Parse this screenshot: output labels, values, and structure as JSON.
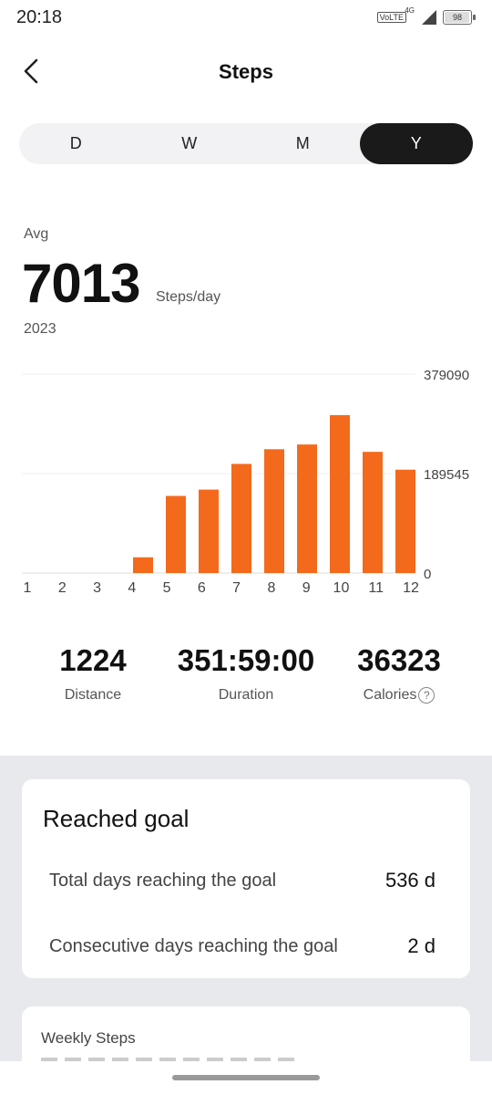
{
  "status_bar": {
    "time": "20:18",
    "volte": "VoLTE",
    "network": "4G",
    "battery": "98",
    "battery_level": 0.98
  },
  "header": {
    "title": "Steps",
    "back_icon": "chevron-left-icon"
  },
  "range_tabs": [
    {
      "label": "D",
      "active": false
    },
    {
      "label": "W",
      "active": false
    },
    {
      "label": "M",
      "active": false
    },
    {
      "label": "Y",
      "active": true
    }
  ],
  "summary": {
    "avg_label": "Avg",
    "avg_value": "7013",
    "avg_unit": "Steps/day",
    "period": "2023"
  },
  "chart_data": {
    "type": "bar",
    "categories": [
      "1",
      "2",
      "3",
      "4",
      "5",
      "6",
      "7",
      "8",
      "9",
      "10",
      "11",
      "12"
    ],
    "values": [
      0,
      0,
      0,
      30000,
      147000,
      159000,
      208000,
      236000,
      245000,
      301000,
      231000,
      197000
    ],
    "y_ticks": [
      "379090",
      "189545",
      "0"
    ],
    "ylim": [
      0,
      379090
    ],
    "bar_color": "#f46a1c",
    "grid": true
  },
  "stats": [
    {
      "value": "1224",
      "label": "Distance",
      "help": false
    },
    {
      "value": "351:59:00",
      "label": "Duration",
      "help": false
    },
    {
      "value": "36323",
      "label": "Calories",
      "help": true
    }
  ],
  "goal": {
    "title": "Reached goal",
    "rows": [
      {
        "label": "Total days reaching the goal",
        "value": "536 d"
      },
      {
        "label": "Consecutive days reaching the goal",
        "value": "2 d"
      }
    ]
  },
  "weekly": {
    "title": "Weekly Steps"
  },
  "colors": {
    "accent": "#f46a1c",
    "tab_active_bg": "#1a1a1a",
    "section_bg": "#e8e9ec"
  }
}
